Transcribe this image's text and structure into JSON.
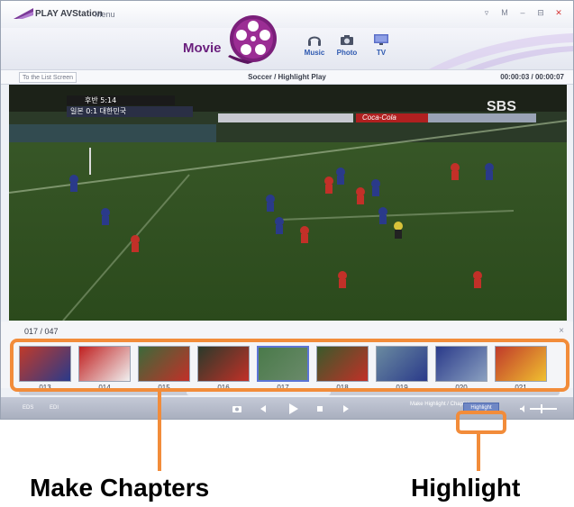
{
  "window": {
    "app_title": "PLAY AVStation",
    "menu": "Menu",
    "controls": [
      "▿",
      "M",
      "–",
      "⊟",
      "✕"
    ]
  },
  "nav": {
    "current": "Movie",
    "items": [
      {
        "label": "Music",
        "icon": "headphones-icon"
      },
      {
        "label": "Photo",
        "icon": "camera-icon"
      },
      {
        "label": "TV",
        "icon": "tv-icon"
      }
    ]
  },
  "infobar": {
    "list_button": "To the List Screen",
    "title": "Soccer / Highlight Play",
    "time": "00:00:03 / 00:00:07"
  },
  "video": {
    "scoreboard_line1": "후반 5:14",
    "scoreboard_line2": "일본 0:1 대한민국",
    "broadcaster": "SBS",
    "ad_text": "Coca-Cola"
  },
  "chapters": {
    "counter": "017 / 047",
    "close": "×",
    "thumbnails": [
      "013",
      "014",
      "015",
      "016",
      "017",
      "018",
      "019",
      "020",
      "021"
    ],
    "selected": "017"
  },
  "controls": {
    "eds": "EDS",
    "edi": "EDI",
    "make_label": "Make Highlight / Chapter",
    "highlight_button": "Highlight"
  },
  "annotations": {
    "left_label": "Make Chapters",
    "right_label": "Highlight",
    "color": "#f28c3a"
  },
  "colors": {
    "accent": "#6a1f7d",
    "nav_blue": "#2e59b0",
    "selection": "#5b74d6"
  }
}
